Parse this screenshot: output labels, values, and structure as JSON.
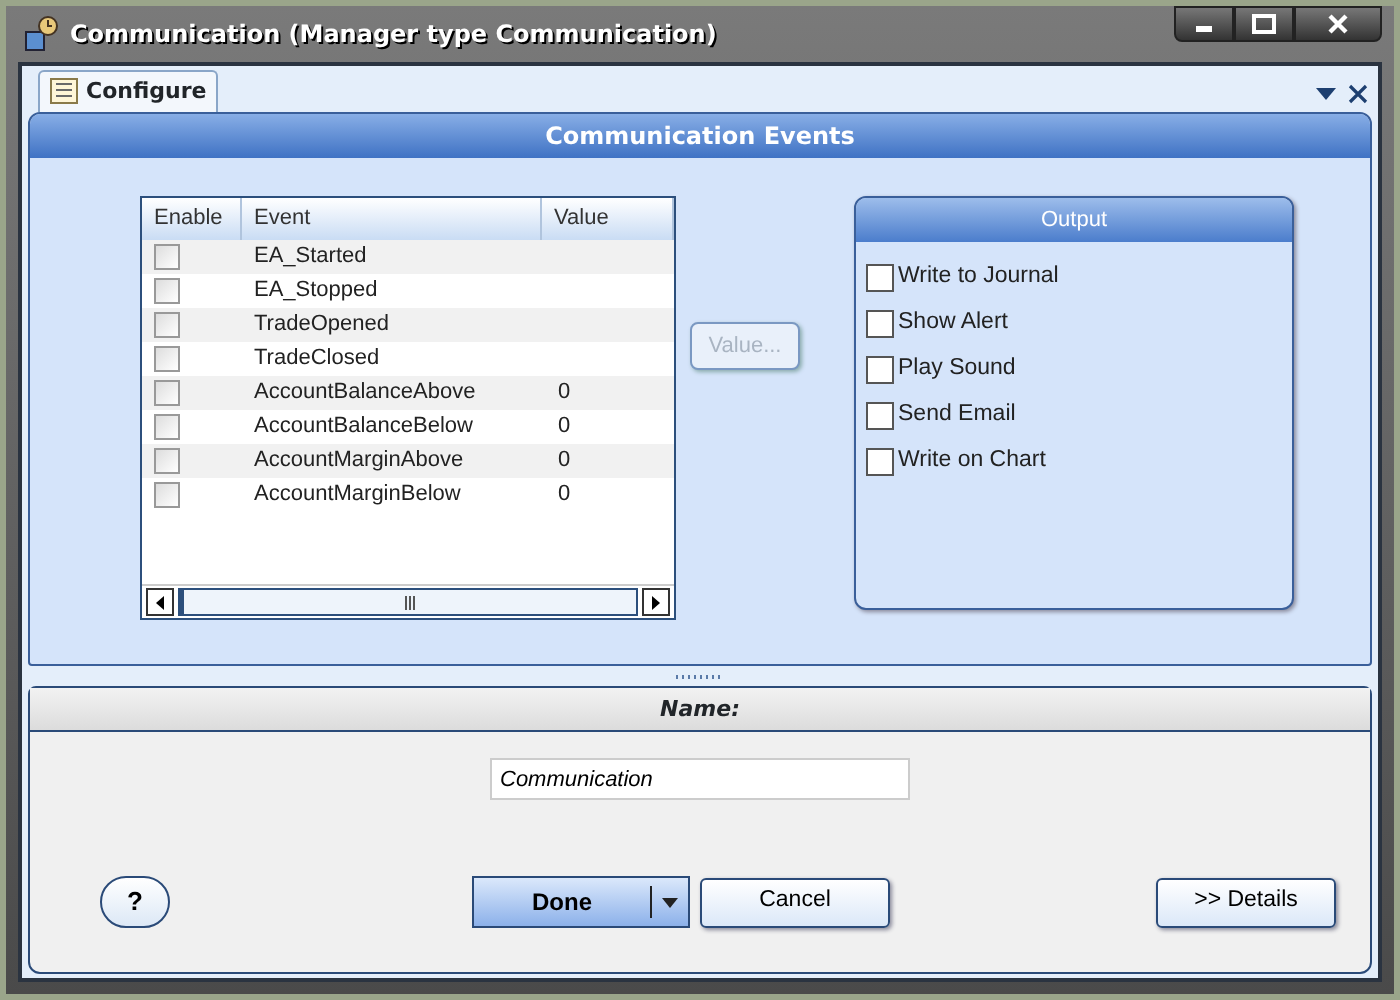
{
  "window": {
    "title": "Communication (Manager type Communication)"
  },
  "tabs": [
    {
      "label": "Configure",
      "selected": true
    }
  ],
  "panel": {
    "title": "Communication Events"
  },
  "events_table": {
    "columns": [
      "Enable",
      "Event",
      "Value"
    ],
    "rows": [
      {
        "enabled": false,
        "event": "EA_Started"
      },
      {
        "enabled": false,
        "event": "EA_Stopped"
      },
      {
        "enabled": false,
        "event": "TradeOpened"
      },
      {
        "enabled": false,
        "event": "TradeClosed"
      },
      {
        "enabled": false,
        "event": "AccountBalanceAbove",
        "value": "0"
      },
      {
        "enabled": false,
        "event": "AccountBalanceBelow",
        "value": "0"
      },
      {
        "enabled": false,
        "event": "AccountMarginAbove",
        "value": "0"
      },
      {
        "enabled": false,
        "event": "AccountMarginBelow",
        "value": "0"
      }
    ]
  },
  "value_button": {
    "label": "Value...",
    "disabled": true
  },
  "output": {
    "title": "Output",
    "options": [
      {
        "label": "Write to Journal",
        "checked": false
      },
      {
        "label": "Show Alert",
        "checked": false
      },
      {
        "label": "Play Sound",
        "checked": false
      },
      {
        "label": "Send Email",
        "checked": false
      },
      {
        "label": "Write on Chart",
        "checked": false
      }
    ]
  },
  "name_section": {
    "title": "Name:",
    "value": "Communication"
  },
  "buttons": {
    "help": "?",
    "done": "Done",
    "cancel": "Cancel",
    "details": ">> Details"
  }
}
